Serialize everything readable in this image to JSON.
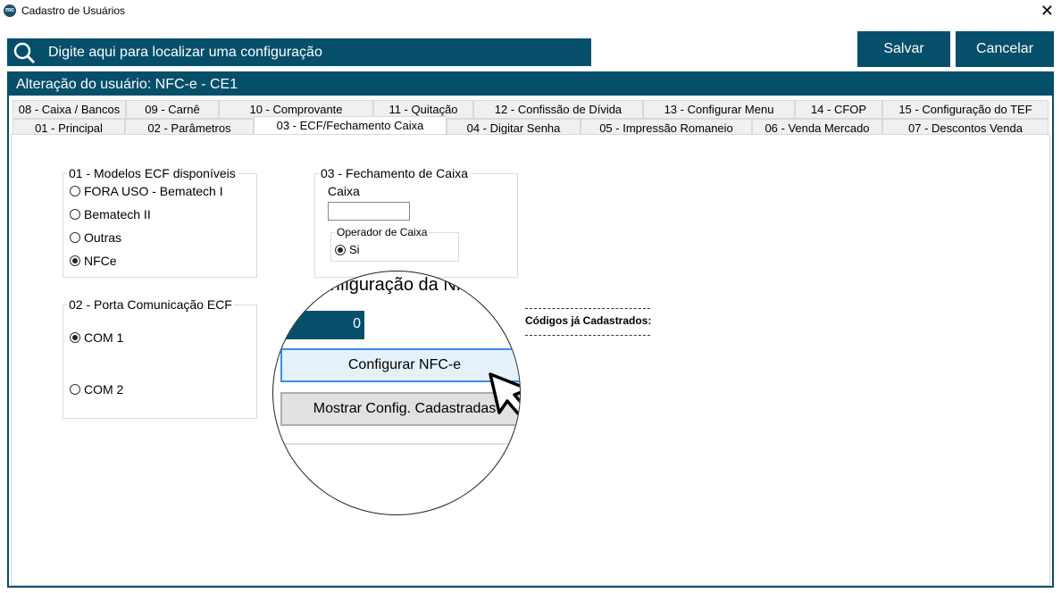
{
  "window": {
    "title": "Cadastro de Usuários",
    "logo_text": "mc",
    "close_icon": "close-icon"
  },
  "search": {
    "placeholder": "Digite aqui para localizar uma configuração",
    "icon": "search-icon"
  },
  "actions": {
    "save": "Salvar",
    "cancel": "Cancelar"
  },
  "panel": {
    "title": "Alteração do usuário: NFC-e - CE1"
  },
  "tabs_row1": [
    "08 - Caixa / Bancos",
    "09 - Carnê",
    "10 - Comprovante",
    "11 - Quitação",
    "12 - Confissão de Dívida",
    "13 - Configurar Menu",
    "14 - CFOP",
    "15 - Configuração do TEF"
  ],
  "tabs_row2": [
    "01 -  Principal",
    "02 - Parâmetros",
    "03 - ECF/Fechamento Caixa",
    "04 - Digitar Senha",
    "05 - Impressão Romaneio",
    "06 - Venda Mercado",
    "07 - Descontos Venda"
  ],
  "active_tab": "03 - ECF/Fechamento Caixa",
  "ecf_models": {
    "legend": "01 - Modelos ECF disponíveis",
    "options": [
      "FORA USO - Bematech I",
      "Bematech II",
      "Outras",
      "NFCe"
    ],
    "selected": "NFCe"
  },
  "port": {
    "legend": "02 - Porta Comunicação ECF",
    "options": [
      "COM 1",
      "COM 2"
    ],
    "selected": "COM 1"
  },
  "closing": {
    "legend": "03 - Fechamento de Caixa",
    "caixa_label": "Caixa",
    "caixa_value": "",
    "operator_legend": "Operador de Caixa",
    "operator_option_partial": "Si"
  },
  "nfce": {
    "title": "Configuração da NFC-e",
    "counter": "0",
    "codes_label": "Códigos já Cadastrados:",
    "configure_button": "Configurar NFC-e",
    "show_button": "Mostrar Config. Cadastradas"
  },
  "colors": {
    "primary": "#054f6a",
    "highlight_border": "#3a8ee6",
    "highlight_bg": "#e5f1fb"
  }
}
